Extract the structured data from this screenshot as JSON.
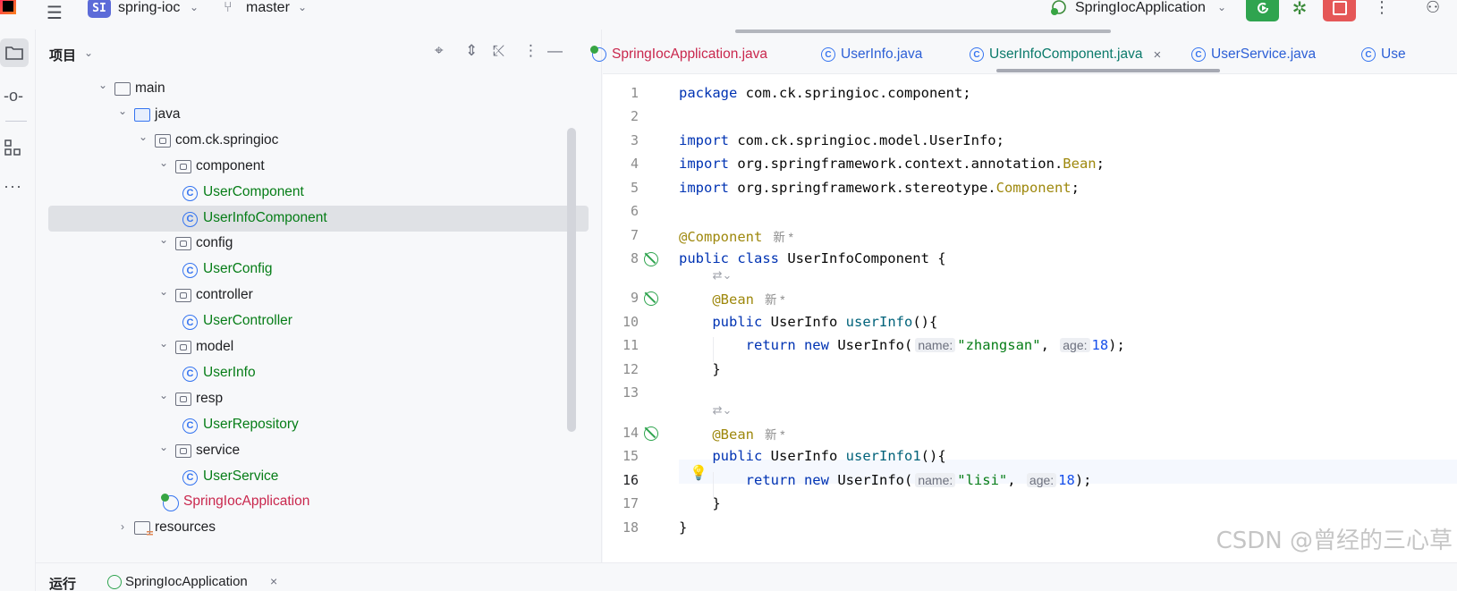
{
  "titlebar": {
    "project_badge": "SI",
    "project_name": "spring-ioc",
    "branch_name": "master",
    "run_config_name": "SpringIocApplication",
    "colors": {
      "run": "#2fa44f",
      "stop": "#e55757",
      "badge": "#5c6bd8"
    }
  },
  "toolstrip": {
    "items": [
      "folder-icon",
      "commit-icon",
      "structure-icon",
      "more-icon"
    ]
  },
  "project_panel": {
    "title": "项目",
    "tree": [
      {
        "label": "main",
        "kind": "folder",
        "depth": 0,
        "expanded": true
      },
      {
        "label": "java",
        "kind": "source-folder",
        "depth": 1,
        "expanded": true
      },
      {
        "label": "com.ck.springioc",
        "kind": "package",
        "depth": 2,
        "expanded": true
      },
      {
        "label": "component",
        "kind": "package",
        "depth": 3,
        "expanded": true
      },
      {
        "label": "UserComponent",
        "kind": "class",
        "depth": 4
      },
      {
        "label": "UserInfoComponent",
        "kind": "class",
        "depth": 4,
        "selected": true
      },
      {
        "label": "config",
        "kind": "package",
        "depth": 3,
        "expanded": true
      },
      {
        "label": "UserConfig",
        "kind": "class",
        "depth": 4
      },
      {
        "label": "controller",
        "kind": "package",
        "depth": 3,
        "expanded": true
      },
      {
        "label": "UserController",
        "kind": "class",
        "depth": 4
      },
      {
        "label": "model",
        "kind": "package",
        "depth": 3,
        "expanded": true
      },
      {
        "label": "UserInfo",
        "kind": "class",
        "depth": 4
      },
      {
        "label": "resp",
        "kind": "package",
        "depth": 3,
        "expanded": true
      },
      {
        "label": "UserRepository",
        "kind": "class",
        "depth": 4
      },
      {
        "label": "service",
        "kind": "package",
        "depth": 3,
        "expanded": true
      },
      {
        "label": "UserService",
        "kind": "class",
        "depth": 4
      },
      {
        "label": "SpringIocApplication",
        "kind": "app",
        "depth": 3
      },
      {
        "label": "resources",
        "kind": "resources",
        "depth": 1,
        "expanded": false
      }
    ]
  },
  "editor": {
    "tabs": [
      {
        "label": "SpringIocApplication.java",
        "kind": "app"
      },
      {
        "label": "UserInfo.java",
        "kind": "class"
      },
      {
        "label": "UserInfoComponent.java",
        "kind": "class",
        "active": true,
        "close": "×"
      },
      {
        "label": "UserService.java",
        "kind": "class"
      },
      {
        "label": "Use",
        "kind": "class"
      }
    ],
    "current_line": "16",
    "lines": [
      {
        "n": "1",
        "tokens": [
          [
            "kw",
            "package"
          ],
          [
            "",
            "com.ck.springioc.component;"
          ]
        ]
      },
      {
        "n": "2",
        "tokens": []
      },
      {
        "n": "3",
        "tokens": [
          [
            "kw",
            "import"
          ],
          [
            "",
            "com.ck.springioc.model.UserInfo;"
          ]
        ]
      },
      {
        "n": "4",
        "tokens": [
          [
            "kw",
            "import"
          ],
          [
            "",
            "org.springframework.context.annotation."
          ],
          [
            "ann",
            "Bean"
          ],
          [
            "",
            ";"
          ]
        ]
      },
      {
        "n": "5",
        "tokens": [
          [
            "kw",
            "import"
          ],
          [
            "",
            "org.springframework.stereotype."
          ],
          [
            "ann",
            "Component"
          ],
          [
            "",
            ";"
          ]
        ]
      },
      {
        "n": "6",
        "tokens": []
      },
      {
        "n": "7",
        "tokens": [
          [
            "ann",
            "@Component"
          ],
          [
            "meta",
            "新 *"
          ]
        ]
      },
      {
        "n": "8",
        "tokens": [
          [
            "kw",
            "public class"
          ],
          [
            "",
            "UserInfoComponent {"
          ]
        ]
      },
      {
        "n": "9",
        "tokens": [
          [
            "ind",
            "    "
          ],
          [
            "ann",
            "@Bean"
          ],
          [
            "meta",
            "新 *"
          ]
        ]
      },
      {
        "n": "10",
        "tokens": [
          [
            "ind",
            "    "
          ],
          [
            "kw",
            "public"
          ],
          [
            "",
            "UserInfo "
          ],
          [
            "fn",
            "userInfo"
          ],
          [
            "",
            "(){"
          ]
        ]
      },
      {
        "n": "11",
        "tokens": [
          [
            "ind",
            "        "
          ],
          [
            "kw",
            "return new"
          ],
          [
            "",
            "UserInfo("
          ],
          [
            "hint",
            "name:"
          ],
          [
            "str",
            "\"zhangsan\""
          ],
          [
            "",
            ", "
          ],
          [
            "hint",
            "age:"
          ],
          [
            "num",
            "18"
          ],
          [
            "",
            ");"
          ]
        ]
      },
      {
        "n": "12",
        "tokens": [
          [
            "ind",
            "    "
          ],
          [
            "",
            "}"
          ]
        ]
      },
      {
        "n": "13",
        "tokens": []
      },
      {
        "n": "14",
        "tokens": [
          [
            "ind",
            "    "
          ],
          [
            "ann",
            "@Bean"
          ],
          [
            "meta",
            "新 *"
          ]
        ]
      },
      {
        "n": "15",
        "tokens": [
          [
            "ind",
            "    "
          ],
          [
            "kw",
            "public"
          ],
          [
            "",
            "UserInfo "
          ],
          [
            "fn",
            "userInfo1"
          ],
          [
            "",
            "(){"
          ]
        ]
      },
      {
        "n": "16",
        "tokens": [
          [
            "ind",
            "        "
          ],
          [
            "kw",
            "return new"
          ],
          [
            "",
            "UserInfo("
          ],
          [
            "hint",
            "name:"
          ],
          [
            "str",
            "\"lisi\""
          ],
          [
            "",
            ", "
          ],
          [
            "hint",
            "age:"
          ],
          [
            "num",
            "18"
          ],
          [
            "",
            ");"
          ]
        ]
      },
      {
        "n": "17",
        "tokens": [
          [
            "ind",
            "    "
          ],
          [
            "",
            "}"
          ]
        ]
      },
      {
        "n": "18",
        "tokens": [
          [
            "",
            "}"
          ]
        ]
      }
    ],
    "gutter_icons": [
      "8",
      "9",
      "14"
    ],
    "codevision_hint": "⇄⌄"
  },
  "bottom_bar": {
    "run_label": "运行",
    "app_label": "SpringIocApplication",
    "close": "×"
  },
  "watermark": "CSDN @曾经的三心草"
}
